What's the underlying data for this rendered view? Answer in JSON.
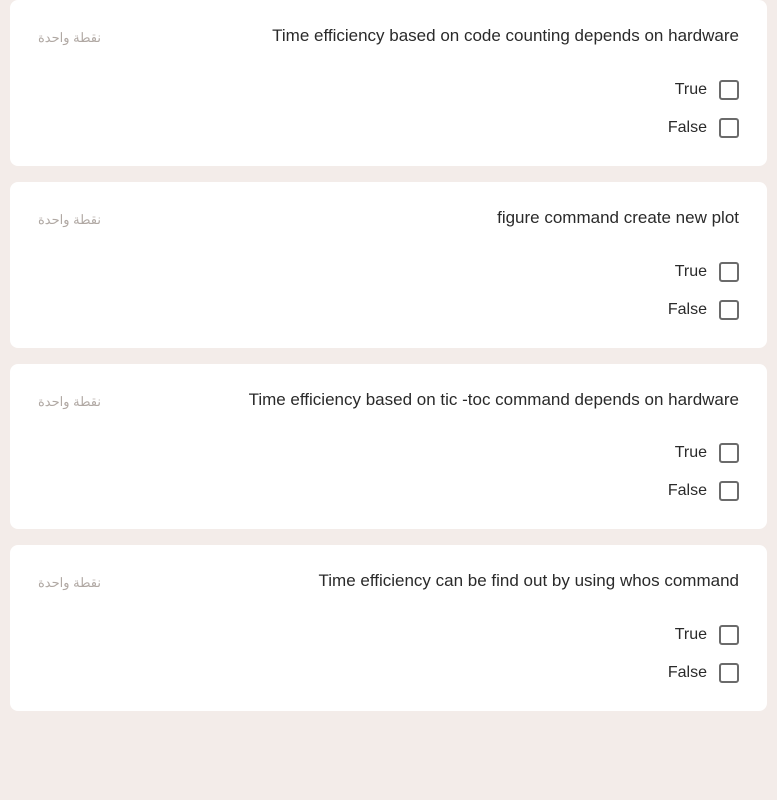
{
  "questions": [
    {
      "points": "نقطة واحدة",
      "text": "Time efficiency based on code counting depends on hardware",
      "options": [
        "True",
        "False"
      ]
    },
    {
      "points": "نقطة واحدة",
      "text": "figure command create new plot",
      "options": [
        "True",
        "False"
      ]
    },
    {
      "points": "نقطة واحدة",
      "text": "Time efficiency based on tic -toc command depends on hardware",
      "options": [
        "True",
        "False"
      ]
    },
    {
      "points": "نقطة واحدة",
      "text": "Time efficiency can be find out by using whos command",
      "options": [
        "True",
        "False"
      ]
    }
  ]
}
